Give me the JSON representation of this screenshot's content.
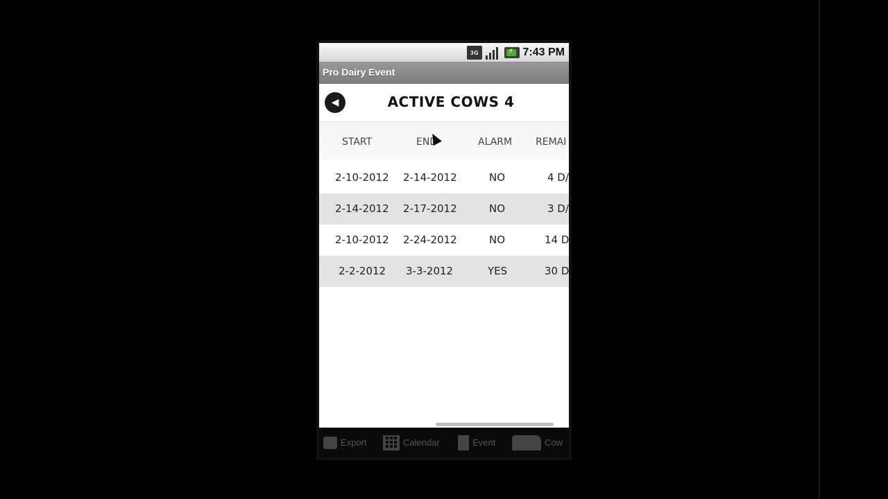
{
  "status_bar": {
    "network": "3G",
    "time": "7:43 PM"
  },
  "app": {
    "title": "Pro Dairy Event"
  },
  "header": {
    "title": "ACTIVE COWS 4",
    "back_icon": "back-arrow-icon"
  },
  "table": {
    "columns": [
      "START",
      "END",
      "ALARM",
      "REMAI"
    ],
    "rows": [
      [
        "2-10-2012",
        "2-14-2012",
        "NO",
        "4 D/"
      ],
      [
        "2-14-2012",
        "2-17-2012",
        "NO",
        "3 D/"
      ],
      [
        "2-10-2012",
        "2-24-2012",
        "NO",
        "14 D"
      ],
      [
        "2-2-2012",
        "3-3-2012",
        "YES",
        "30 D"
      ]
    ]
  },
  "tabs": [
    {
      "label": "Export",
      "icon": "export-icon"
    },
    {
      "label": "Calendar",
      "icon": "calendar-icon"
    },
    {
      "label": "Event",
      "icon": "event-icon"
    },
    {
      "label": "Cow",
      "icon": "cow-icon"
    }
  ]
}
